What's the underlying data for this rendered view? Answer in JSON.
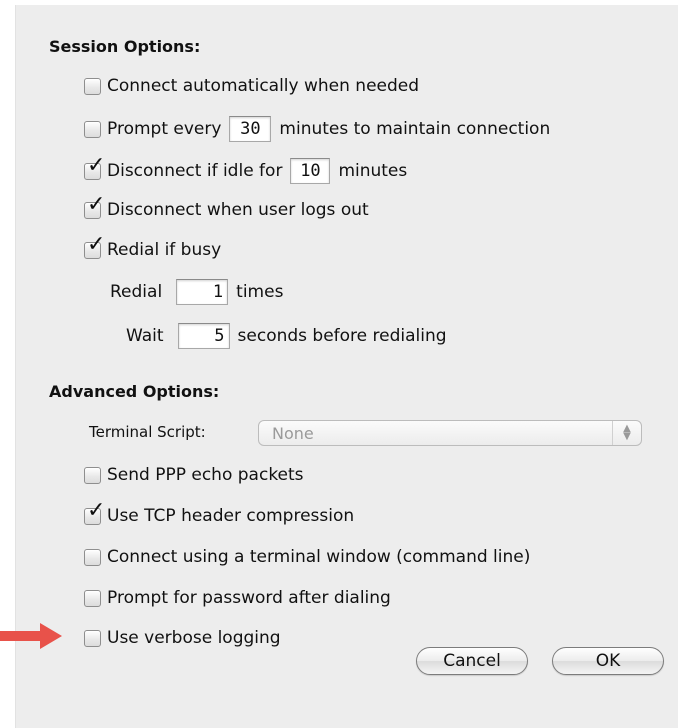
{
  "session": {
    "heading": "Session Options:",
    "connect_auto": {
      "label": "Connect automatically when needed",
      "checked": false
    },
    "prompt_every": {
      "label_before": "Prompt every",
      "value": "30",
      "label_after": "minutes to maintain connection",
      "checked": false
    },
    "disconnect_idle": {
      "label_before": "Disconnect if idle for",
      "value": "10",
      "label_after": "minutes",
      "checked": true
    },
    "disconnect_logout": {
      "label": "Disconnect when user logs out",
      "checked": true
    },
    "redial_busy": {
      "label": "Redial if busy",
      "checked": true
    },
    "redial_times": {
      "label_before": "Redial",
      "value": "1",
      "label_after": "times"
    },
    "wait_seconds": {
      "label_before": "Wait",
      "value": "5",
      "label_after": "seconds before redialing"
    }
  },
  "advanced": {
    "heading": "Advanced Options:",
    "terminal_script": {
      "label": "Terminal Script:",
      "value": "None"
    },
    "ppp_echo": {
      "label": "Send PPP echo packets",
      "checked": false
    },
    "tcp_compression": {
      "label": "Use TCP header compression",
      "checked": true
    },
    "terminal_window": {
      "label": "Connect using a terminal window (command line)",
      "checked": false
    },
    "prompt_password": {
      "label": "Prompt for password after dialing",
      "checked": false
    },
    "verbose_logging": {
      "label": "Use verbose logging",
      "checked": false
    }
  },
  "buttons": {
    "cancel": "Cancel",
    "ok": "OK"
  },
  "checkmark_glyph": "✓",
  "colors": {
    "pointer_arrow": "#e8524a",
    "dialog_bg": "#ededed"
  }
}
